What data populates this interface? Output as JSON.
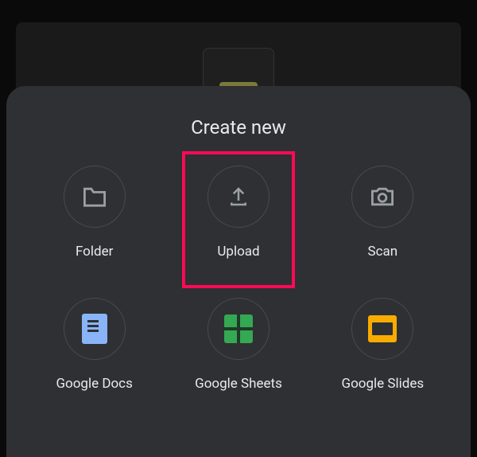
{
  "sheet": {
    "title": "Create new",
    "options": [
      {
        "label": "Folder"
      },
      {
        "label": "Upload"
      },
      {
        "label": "Scan"
      },
      {
        "label": "Google Docs"
      },
      {
        "label": "Google Sheets"
      },
      {
        "label": "Google Slides"
      }
    ]
  },
  "highlight": {
    "target": "upload-option",
    "color": "#ff0956"
  }
}
